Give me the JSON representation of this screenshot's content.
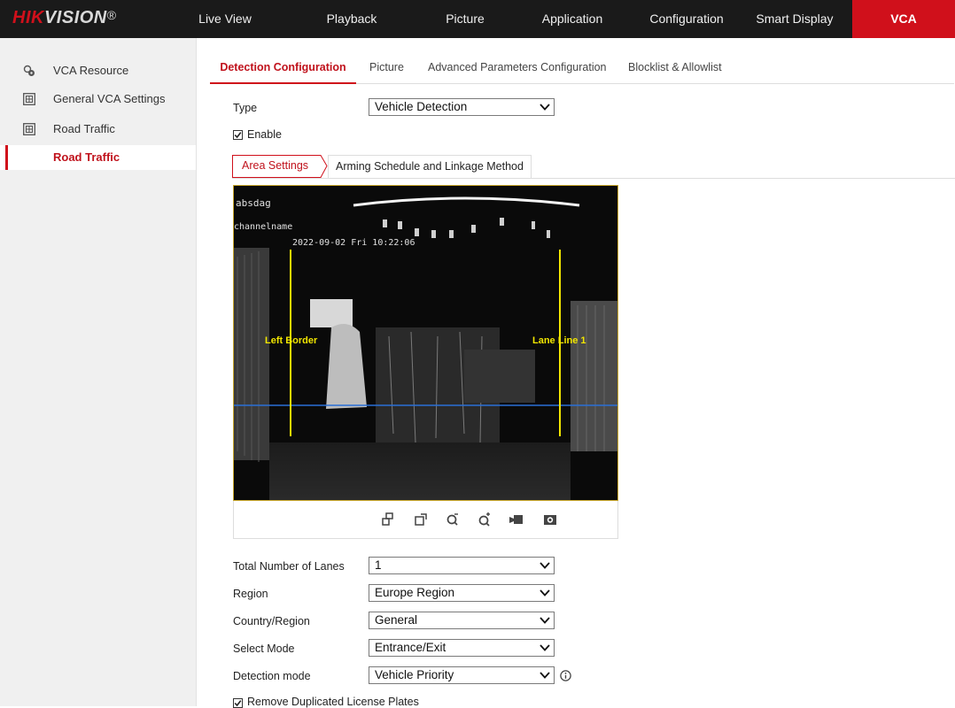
{
  "brand": {
    "logo_main": "HIK",
    "logo_rest": "VISION",
    "logo_mark": "®"
  },
  "nav": [
    {
      "label": "Live View"
    },
    {
      "label": "Playback"
    },
    {
      "label": "Picture"
    },
    {
      "label": "Application"
    },
    {
      "label": "Configuration"
    },
    {
      "label": "Smart Display"
    },
    {
      "label": "VCA",
      "active": true
    }
  ],
  "sidebar": {
    "items": [
      {
        "label": "VCA Resource",
        "icon": "vca-resource-icon"
      },
      {
        "label": "General VCA Settings",
        "icon": "grid-icon"
      },
      {
        "label": "Road Traffic",
        "icon": "grid-icon"
      }
    ],
    "sub_item": {
      "label": "Road Traffic"
    }
  },
  "tabs": [
    {
      "label": "Detection Configuration",
      "active": true
    },
    {
      "label": "Picture"
    },
    {
      "label": "Advanced Parameters Configuration"
    },
    {
      "label": "Blocklist & Allowlist"
    }
  ],
  "form": {
    "type_label": "Type",
    "type_value": "Vehicle Detection",
    "enable_label": "Enable",
    "enable_checked": true
  },
  "subtabs": {
    "area": "Area Settings",
    "arming": "Arming Schedule and Linkage Method"
  },
  "video": {
    "osd_name": "absdag",
    "osd_channel": "channelname",
    "osd_time": "2022-09-02 Fri 10:22:06",
    "left_border_label": "Left Border",
    "lane_line_label": "Lane Line 1",
    "line_color": "#f2e600",
    "detection_line_color": "#2a6fd6"
  },
  "toolbar_icons": [
    "restore-window-icon",
    "maximize-window-icon",
    "zoom-out-icon",
    "zoom-in-icon",
    "record-icon",
    "snapshot-icon"
  ],
  "lanes": {
    "total_lanes_label": "Total Number of Lanes",
    "total_lanes_value": "1",
    "region_label": "Region",
    "region_value": "Europe Region",
    "country_label": "Country/Region",
    "country_value": "General",
    "mode_label": "Select Mode",
    "mode_value": "Entrance/Exit",
    "detection_mode_label": "Detection mode",
    "detection_mode_value": "Vehicle Priority",
    "remove_dup_label": "Remove Duplicated License Plates"
  },
  "colors": {
    "accent": "#d0101b",
    "topbar": "#1a1a1a",
    "sidebar": "#f0f0f0"
  }
}
